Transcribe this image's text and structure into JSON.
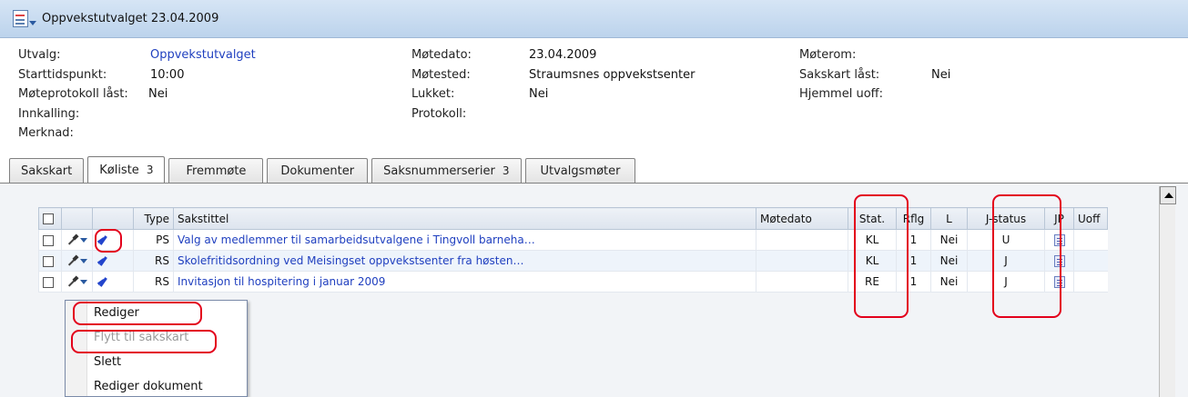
{
  "window": {
    "title": "Oppvekstutvalget 23.04.2009"
  },
  "meta": {
    "col1": [
      {
        "label": "Utvalg:",
        "value": "Oppvekstutvalget",
        "link": true
      },
      {
        "label": "Starttidspunkt:",
        "value": "10:00"
      },
      {
        "label": "Møteprotokoll låst:",
        "value": "Nei"
      },
      {
        "label": "Innkalling:",
        "value": ""
      },
      {
        "label": "Merknad:",
        "value": ""
      }
    ],
    "col2": [
      {
        "label": "Møtedato:",
        "value": "23.04.2009"
      },
      {
        "label": "Møtested:",
        "value": "Straumsnes oppvekstsenter"
      },
      {
        "label": "Lukket:",
        "value": "Nei"
      },
      {
        "label": "Protokoll:",
        "value": ""
      }
    ],
    "col3": [
      {
        "label": "Møterom:",
        "value": ""
      },
      {
        "label": "Sakskart låst:",
        "value": "Nei"
      },
      {
        "label": "Hjemmel uoff:",
        "value": ""
      }
    ]
  },
  "tabs": [
    {
      "label": "Sakskart",
      "count": ""
    },
    {
      "label": "Køliste",
      "count": "3",
      "active": true
    },
    {
      "label": "Fremmøte",
      "count": ""
    },
    {
      "label": "Dokumenter",
      "count": ""
    },
    {
      "label": "Saksnummerserier",
      "count": "3"
    },
    {
      "label": "Utvalgsmøter",
      "count": ""
    }
  ],
  "grid": {
    "headers": {
      "type": "Type",
      "sakstittel": "Sakstittel",
      "motedato": "Møtedato",
      "stat": "Stat.",
      "rflg": "Rflg",
      "l": "L",
      "jstatus": "J-status",
      "jp": "JP",
      "uoff": "Uoff"
    },
    "rows": [
      {
        "type": "PS",
        "sakstittel": "Valg av medlemmer til samarbeidsutvalgene i Tingvoll barneha…",
        "motedato": "",
        "stat": "KL",
        "rflg": "1",
        "l": "Nei",
        "jstatus": "U"
      },
      {
        "type": "RS",
        "sakstittel": "Skolefritidsordning ved Meisingset oppvekstsenter fra høsten…",
        "motedato": "",
        "stat": "KL",
        "rflg": "1",
        "l": "Nei",
        "jstatus": "J"
      },
      {
        "type": "RS",
        "sakstittel": "Invitasjon til hospitering i januar 2009",
        "motedato": "",
        "stat": "RE",
        "rflg": "1",
        "l": "Nei",
        "jstatus": "J"
      }
    ]
  },
  "context_menu": {
    "items": [
      {
        "label": "Rediger",
        "disabled": false
      },
      {
        "label": "Flytt til sakskart",
        "disabled": true
      },
      {
        "label": "Slett",
        "disabled": false
      },
      {
        "label": "Rediger dokument",
        "disabled": false
      }
    ]
  },
  "colors": {
    "link": "#1f3fbf",
    "highlight": "#e3001b",
    "titlebar": "#c8dcf0"
  }
}
